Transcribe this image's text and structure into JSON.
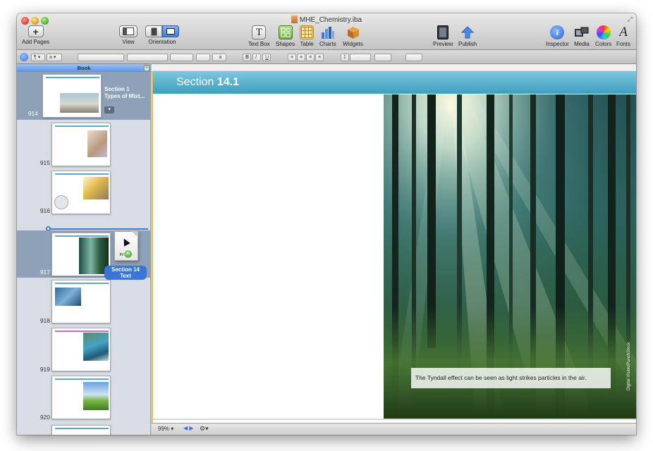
{
  "window": {
    "title": "MHE_Chemistry.iba"
  },
  "toolbar": {
    "add_pages": "Add Pages",
    "view": "View",
    "orientation": "Orientation",
    "text_box": "Text Box",
    "shapes": "Shapes",
    "table": "Table",
    "charts": "Charts",
    "widgets": "Widgets",
    "preview": "Preview",
    "publish": "Publish",
    "inspector": "Inspector",
    "media": "Media",
    "colors": "Colors",
    "fonts": "Fonts"
  },
  "formatbar": {
    "style_a": "a",
    "bold": "B",
    "italic": "I",
    "underline": "U",
    "char_a": "a"
  },
  "sidebar": {
    "header": "Book",
    "menu_glyph": "≡",
    "section_label_line1": "Section 1",
    "section_label_line2": "Types of Mixt...",
    "pages": [
      {
        "num": "914"
      },
      {
        "num": "915"
      },
      {
        "num": "916"
      },
      {
        "num": "917"
      },
      {
        "num": "918"
      },
      {
        "num": "919"
      },
      {
        "num": "920"
      }
    ],
    "drag_file_caption": "PAGES",
    "drag_label_line1": "Section 14",
    "drag_label_line2": "Text"
  },
  "canvas": {
    "section_prefix": "Section",
    "section_number": "14.1",
    "caption": "The Tyndall effect can be seen as light strikes particles in the air.",
    "photo_credit": "Digital Vision/PunchStock"
  },
  "statusbar": {
    "zoom": "99%"
  },
  "colors": {
    "header_blue": "#4ba7c4",
    "selection": "#8fa1b8",
    "accent": "#3a74d6"
  }
}
